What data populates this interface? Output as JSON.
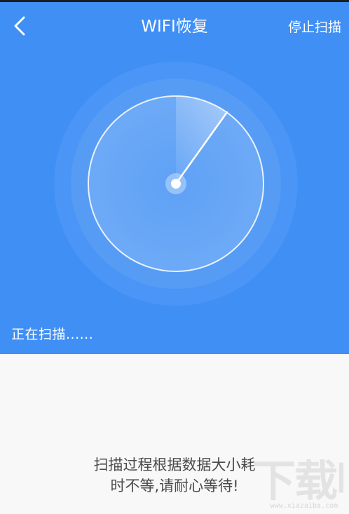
{
  "header": {
    "title": "WIFI恢复",
    "stop_label": "停止扫描",
    "back_icon": "chevron-left-icon"
  },
  "scan": {
    "status_text": "正在扫描......"
  },
  "hint": {
    "line1": "扫描过程根据数据大小耗",
    "line2": "时不等,请耐心等待!"
  },
  "watermark": {
    "logo_text": "下载吧",
    "site_text": "www.xiazaiba.com"
  },
  "colors": {
    "primary": "#3f8ff5",
    "text_on_primary": "#ffffff",
    "hint_text": "#4a4a4a",
    "background": "#f8f8f8"
  }
}
